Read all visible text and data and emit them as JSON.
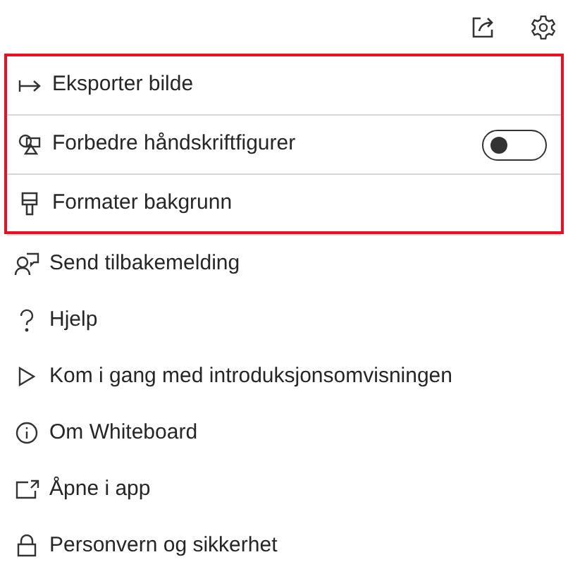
{
  "highlighted_items": [
    {
      "kind": "action",
      "label": "Eksporter bilde"
    },
    {
      "kind": "toggle",
      "label": "Forbedre håndskriftfigurer",
      "on": false
    },
    {
      "kind": "action",
      "label": "Formater bakgrunn"
    }
  ],
  "items": [
    {
      "label": "Send tilbakemelding"
    },
    {
      "label": "Hjelp"
    },
    {
      "label": "Kom i gang med introduksjonsomvisningen"
    },
    {
      "label": "Om Whiteboard"
    },
    {
      "label": "Åpne i app"
    },
    {
      "label": "Personvern og sikkerhet"
    }
  ]
}
